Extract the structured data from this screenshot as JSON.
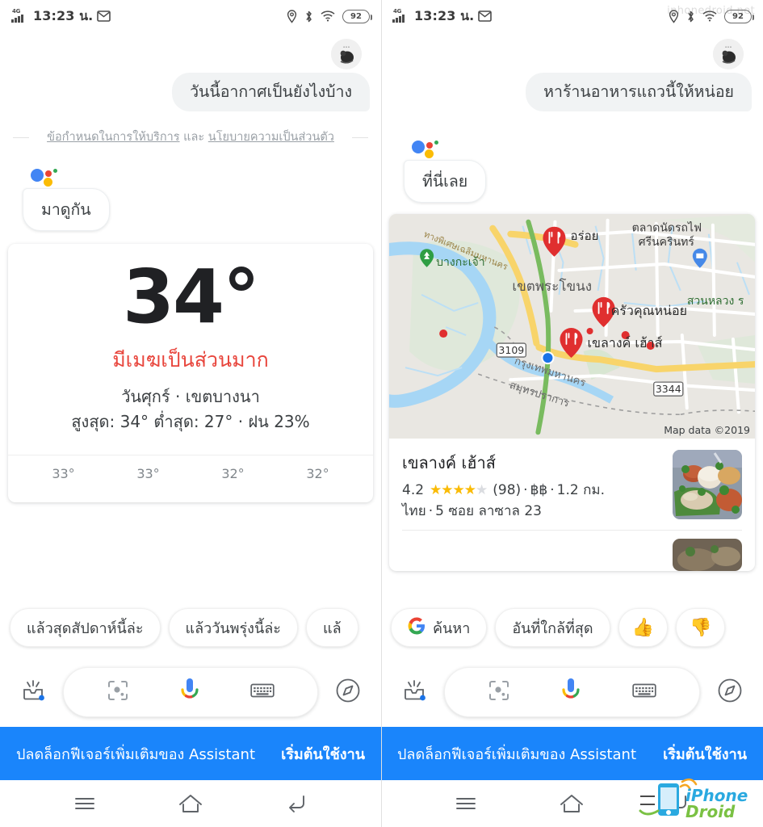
{
  "status_bar": {
    "network": "4G",
    "time": "13:23 น.",
    "mail_icon": "mail-icon",
    "location_icon": "location-icon",
    "bluetooth_icon": "bluetooth-icon",
    "wifi_icon": "wifi-icon",
    "battery": "92"
  },
  "watermark": {
    "top_text": "iphonedroid.net",
    "logo_line1": "iPhone",
    "logo_line2": "Droid"
  },
  "left": {
    "user_message": "วันนี้อากาศเป็นยังไงบ้าง",
    "legal": {
      "terms": "ข้อกำหนดในการให้บริการ",
      "and": " และ ",
      "privacy": "นโยบายความเป็นส่วนตัว"
    },
    "assistant_reply": "มาดูกัน",
    "weather": {
      "temperature": "34°",
      "condition": "มีเมฆเป็นส่วนมาก",
      "day_location": "วันศุกร์ · เขตบางนา",
      "high_low_rain": "สูงสุด: 34° ต่ำสุด: 27° · ฝน 23%",
      "forecast": [
        "33°",
        "33°",
        "32°",
        "32°"
      ]
    },
    "chips": [
      {
        "label": "แล้วสุดสัปดาห์นี้ล่ะ"
      },
      {
        "label": "แล้ววันพรุ่งนี้ล่ะ"
      },
      {
        "label": "แล้"
      }
    ]
  },
  "right": {
    "user_message": "หาร้านอาหารแถวนี้ให้หน่อย",
    "assistant_reply": "ที่นี่เลย",
    "map": {
      "attribution": "Map data ©2019",
      "labels": [
        {
          "text": "ทางพิเศษเฉลิมมหานคร",
          "kind": "highway-label"
        },
        {
          "text": "บางกะเจ้า",
          "kind": "park-label"
        },
        {
          "text": "อร่อย",
          "kind": "restaurant-pin-label"
        },
        {
          "text": "ตลาดนัดรถไฟ",
          "kind": "market-label"
        },
        {
          "text": "ศรีนครินทร์",
          "kind": "market-label"
        },
        {
          "text": "เขตพระโขนง",
          "kind": "district-label"
        },
        {
          "text": "สวนหลวง ร",
          "kind": "park-label"
        },
        {
          "text": "ครัวคุณหน่อย",
          "kind": "restaurant-pin-label"
        },
        {
          "text": "เขลางค์ เฮ้าส์",
          "kind": "restaurant-pin-label"
        },
        {
          "text": "3109",
          "kind": "route-shield"
        },
        {
          "text": "3344",
          "kind": "route-shield"
        },
        {
          "text": "กรุงเทพมหานคร",
          "kind": "boundary-label"
        },
        {
          "text": "สมุทรปราการ",
          "kind": "boundary-label"
        }
      ]
    },
    "place": {
      "name": "เขลางค์ เฮ้าส์",
      "rating": "4.2",
      "stars_filled": 4,
      "stars_total": 5,
      "review_count": "(98)",
      "price": "฿฿",
      "distance": "1.2 กม.",
      "cuisine": "ไทย",
      "address": "5 ซอย ลาซาล 23",
      "sep1": "·",
      "sep2": "·",
      "sep3": "·"
    },
    "chips": [
      {
        "label": "ค้นหา",
        "icon": "google-g-icon"
      },
      {
        "label": "อันที่ใกล้ที่สุด",
        "icon": ""
      },
      {
        "label": "👍",
        "icon": "thumbs-up-icon"
      },
      {
        "label": "👎",
        "icon": "thumbs-down-icon"
      }
    ]
  },
  "input_bar": {
    "inbox_icon": "inbox-icon",
    "lens_icon": "google-lens-icon",
    "mic_icon": "microphone-icon",
    "keyboard_icon": "keyboard-icon",
    "explore_icon": "explore-compass-icon"
  },
  "promo": {
    "text": "ปลดล็อกฟีเจอร์เพิ่มเติมของ Assistant",
    "cta": "เริ่มต้นใช้งาน"
  },
  "nav_bar": {
    "recents_icon": "menu-recents-icon",
    "home_icon": "home-icon",
    "back_icon": "back-icon"
  },
  "colors": {
    "accent_blue": "#1a85fb",
    "condition_red": "#e8453c",
    "star_gold": "#fabb05",
    "pin_red": "#e02f2f"
  }
}
